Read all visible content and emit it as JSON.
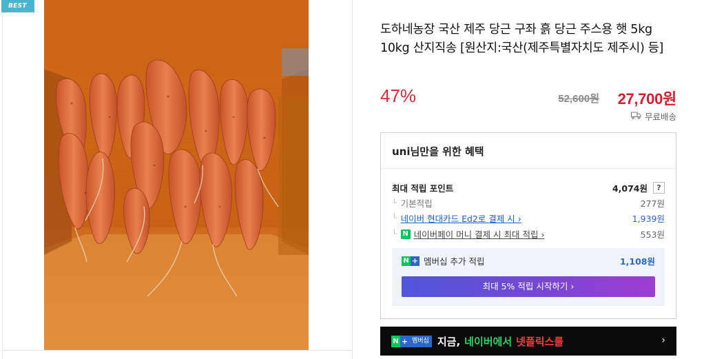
{
  "badge": "BEST",
  "product": {
    "title": "도하네농장 국산 제주 당근 구좌 흙 당근 주스용 햇 5kg 10kg 산지직송 [원산지:국산(제주특별자치도 제주시) 등]",
    "discount": "47%",
    "original_price": "52,600원",
    "sale_price": "27,700원",
    "delivery": "무료배송"
  },
  "benefit": {
    "heading": "uni님만을 위한 혜택",
    "max_points_label": "최대 적립 포인트",
    "max_points_value": "4,074원",
    "help_label": "?",
    "rows": [
      {
        "label": "기본적립",
        "value": "277원"
      },
      {
        "label": "네이버 현대카드 Ed2로 결제 시 ›",
        "value": "1,939원"
      },
      {
        "label": "네이버페이 머니 결제 시 최대 적립 ›",
        "value": "553원"
      }
    ],
    "membership_label": "멤버십 추가 적립",
    "membership_value": "1,108원",
    "start_button": "최대 5% 적립 시작하기 ›"
  },
  "banner": {
    "tag": "멤버십",
    "text_white": "지금,",
    "text_green": "네이버에서",
    "text_red": "넷플릭스를",
    "arrow": "›"
  },
  "colors": {
    "discount_red": "#d92c3d",
    "price_red": "#d41e33",
    "badge_blue": "#4bb4cf",
    "link_blue": "#1a5fcf",
    "naver_green": "#03c75a"
  }
}
